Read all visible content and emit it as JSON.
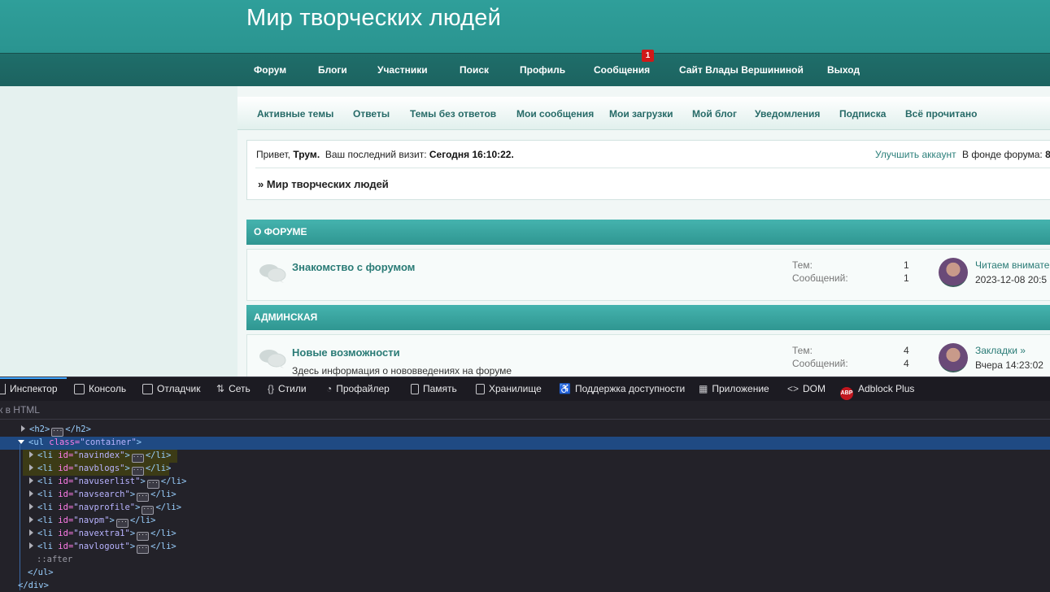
{
  "site": {
    "title": "Мир творческих людей"
  },
  "nav": {
    "items": [
      "Форум",
      "Блоги",
      "Участники",
      "Поиск",
      "Профиль",
      "Сообщения",
      "Сайт Влады Вершининой",
      "Выход"
    ],
    "messages_badge": "1"
  },
  "subnav": {
    "items": [
      "Активные темы",
      "Ответы",
      "Темы без ответов",
      "Мои сообщения",
      "Мои загрузки",
      "Мой блог",
      "Уведомления",
      "Подписка",
      "Всё прочитано"
    ]
  },
  "info": {
    "greeting": "Привет,",
    "username": "Трум.",
    "last_visit_label": "Ваш последний визит:",
    "last_visit_value": "Сегодня 16:10:22.",
    "upgrade_link": "Улучшить аккаунт",
    "fund_label": "В фонде форума:",
    "fund_value": "8",
    "breadcrumb": "» Мир творческих людей"
  },
  "categories": [
    {
      "title": "О ФОРУМЕ",
      "forums": [
        {
          "title": "Знакомство с форумом",
          "description": "",
          "topics_label": "Тем:",
          "topics": "1",
          "posts_label": "Сообщений:",
          "posts": "1",
          "last_post_title": "Читаем внимате",
          "last_post_date": "2023-12-08 20:5"
        }
      ]
    },
    {
      "title": "АДМИНСКАЯ",
      "forums": [
        {
          "title": "Новые возможности",
          "description": "Здесь информация о нововведениях на форуме",
          "topics_label": "Тем:",
          "topics": "4",
          "posts_label": "Сообщений:",
          "posts": "4",
          "last_post_title": "Закладки »",
          "last_post_date": "Вчера 14:23:02"
        }
      ]
    }
  ],
  "devtools": {
    "tabs": [
      "Инспектор",
      "Консоль",
      "Отладчик",
      "Сеть",
      "Стили",
      "Профайлер",
      "Память",
      "Хранилище",
      "Поддержка доступности",
      "Приложение",
      "DOM",
      "Adblock Plus"
    ],
    "abp_icon_text": "ABP",
    "search_placeholder": "к в HTML",
    "tree": {
      "h2_open": "<h2>",
      "h2_close": "</h2>",
      "ul_open": "<ul ",
      "ul_attr": "class=",
      "ul_val": "\"container\"",
      "ul_end": ">",
      "li_ids": [
        "\"navindex\"",
        "\"navblogs\"",
        "\"navuserlist\"",
        "\"navsearch\"",
        "\"navprofile\"",
        "\"navpm\"",
        "\"navextra1\"",
        "\"navlogout\""
      ],
      "li_open": "<li ",
      "li_attr": "id=",
      "li_close": "</li>",
      "after": "::after",
      "ul_close": "</ul>",
      "div_close": "</div>"
    }
  }
}
